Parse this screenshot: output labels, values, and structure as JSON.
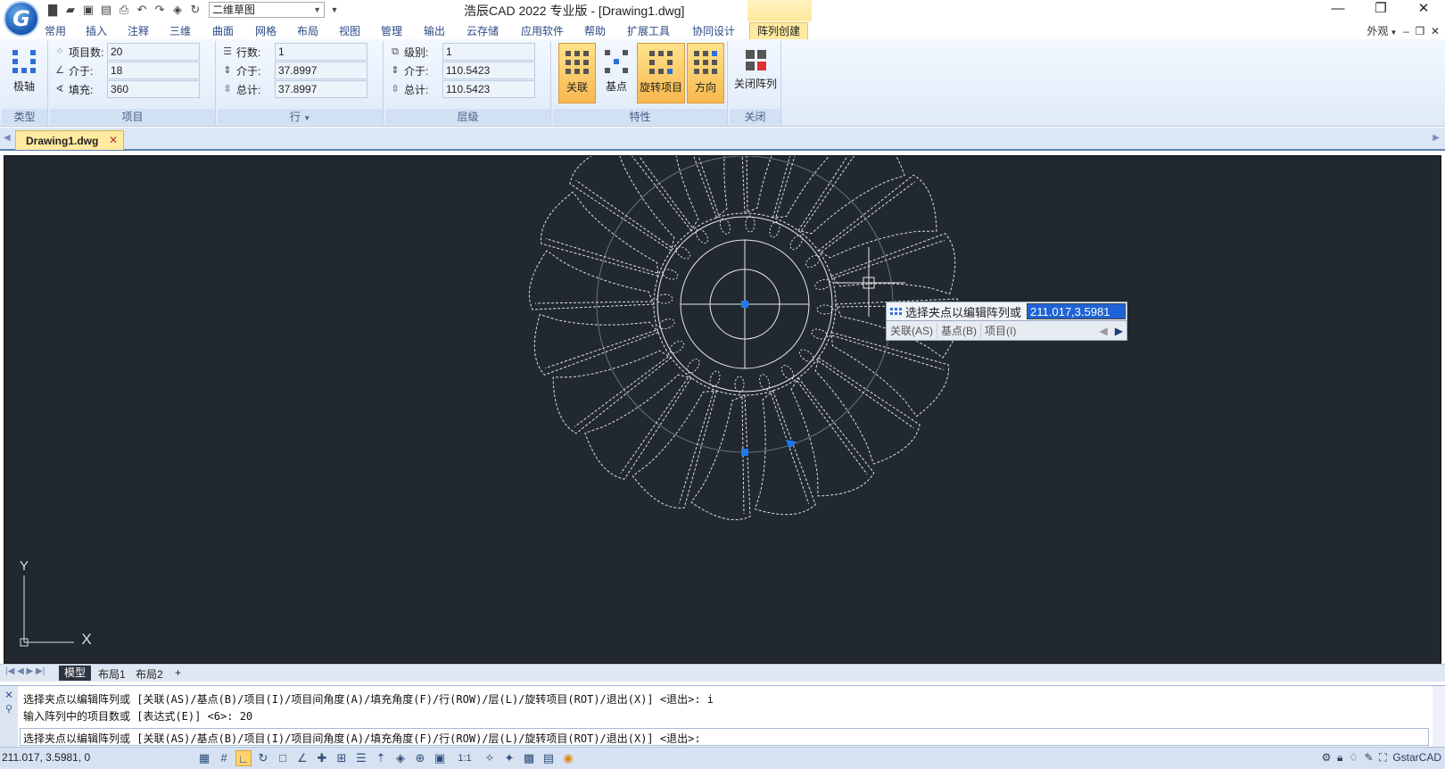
{
  "app": {
    "title": "浩辰CAD 2022 专业版 - [Drawing1.dwg]",
    "logo_letter": "G",
    "workspace": "二维草图"
  },
  "ribbon_tabs": [
    "常用",
    "插入",
    "注释",
    "三维",
    "曲面",
    "网格",
    "布局",
    "视图",
    "管理",
    "输出",
    "云存储",
    "应用软件",
    "帮助",
    "扩展工具",
    "协同设计",
    "阵列创建"
  ],
  "outlook_label": "外观",
  "ribbon": {
    "type_panel": {
      "button": "极轴",
      "title": "类型"
    },
    "items_panel": {
      "title": "项目",
      "rows": [
        {
          "label": "项目数:",
          "value": "20"
        },
        {
          "label": "介于:",
          "value": "18"
        },
        {
          "label": "填充:",
          "value": "360"
        }
      ]
    },
    "rows_panel": {
      "title": "行",
      "rows": [
        {
          "label": "行数:",
          "value": "1"
        },
        {
          "label": "介于:",
          "value": "37.8997"
        },
        {
          "label": "总计:",
          "value": "37.8997"
        }
      ]
    },
    "levels_panel": {
      "title": "层级",
      "rows": [
        {
          "label": "级别:",
          "value": "1"
        },
        {
          "label": "介于:",
          "value": "110.5423"
        },
        {
          "label": "总计:",
          "value": "110.5423"
        }
      ]
    },
    "props_panel": {
      "title": "特性",
      "buttons": [
        "关联",
        "基点",
        "旋转项目",
        "方向"
      ]
    },
    "close_panel": {
      "title": "关闭",
      "button": "关闭阵列"
    }
  },
  "file_tab": {
    "name": "Drawing1.dwg"
  },
  "canvas": {
    "ucs_y": "Y",
    "ucs_x": "X"
  },
  "tooltip": {
    "prompt": "选择夹点以编辑阵列或",
    "value": "211.017,3.5981",
    "options": [
      "关联(AS)",
      "基点(B)",
      "项目(I)"
    ]
  },
  "layout_tabs": [
    "模型",
    "布局1",
    "布局2",
    "+"
  ],
  "command": {
    "lines": [
      "选择夹点以编辑阵列或 [关联(AS)/基点(B)/项目(I)/项目间角度(A)/填充角度(F)/行(ROW)/层(L)/旋转项目(ROT)/退出(X)] <退出>: i",
      "输入阵列中的项目数或 [表达式(E)] <6>: 20",
      "选择夹点以编辑阵列或 [关联(AS)/基点(B)/项目(I)/项目间角度(A)/填充角度(F)/行(ROW)/层(L)/旋转项目(ROT)/退出(X)] <退出>:"
    ]
  },
  "status": {
    "coords": "211.017, 3.5981, 0",
    "scale": "1:1",
    "brand": "GstarCAD"
  }
}
